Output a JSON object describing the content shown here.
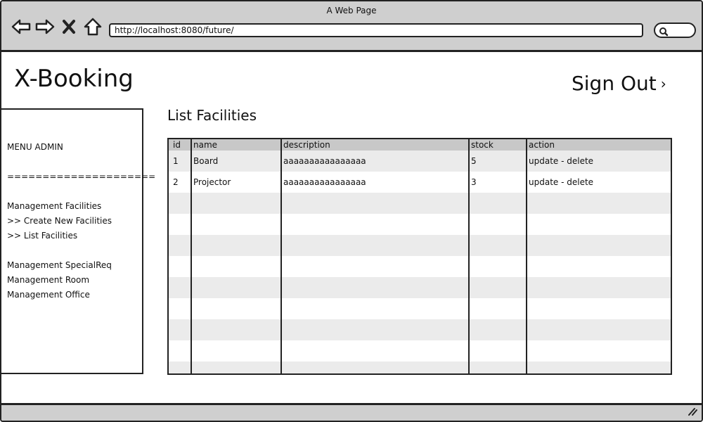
{
  "window": {
    "title": "A Web Page"
  },
  "browser": {
    "url": "http://localhost:8080/future/",
    "nav_icons": [
      "back-arrow-icon",
      "forward-arrow-icon",
      "close-x-icon",
      "home-icon"
    ]
  },
  "header": {
    "brand": "X-Booking",
    "sign_out": "Sign Out",
    "sign_out_chevron": "›"
  },
  "sidebar": {
    "title": "MENU ADMIN",
    "divider": "=====================",
    "items": [
      "Management Facilities",
      ">> Create New Facilities",
      ">> List Facilities",
      "Management SpecialReq",
      "Management Room",
      "Management Office"
    ]
  },
  "main": {
    "heading": "List Facilities",
    "table": {
      "columns": [
        "id",
        "name",
        "description",
        "stock",
        "action"
      ],
      "rows": [
        {
          "id": "1",
          "name": "Board",
          "description": "aaaaaaaaaaaaaaaa",
          "stock": "5",
          "action_update": "update",
          "action_sep": " - ",
          "action_delete": "delete"
        },
        {
          "id": "2",
          "name": "Projector",
          "description": "aaaaaaaaaaaaaaaa",
          "stock": "3",
          "action_update": "update",
          "action_sep": " - ",
          "action_delete": "delete"
        }
      ]
    }
  }
}
